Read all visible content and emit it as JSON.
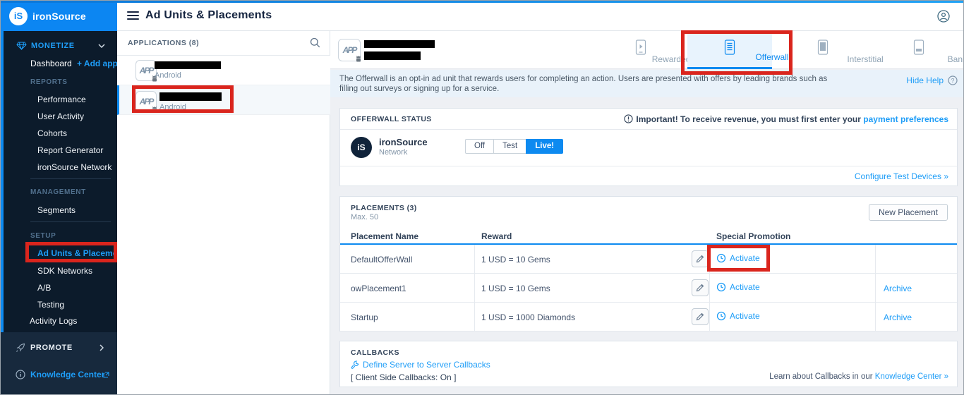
{
  "brand": {
    "logo_text": "iS",
    "name": "ironSource"
  },
  "top_bar": {
    "title": "Ad Units & Placements"
  },
  "sidebar": {
    "monetize_label": "MONETIZE",
    "dashboard_label": "Dashboard",
    "add_app_label": "+ Add app",
    "reports_label": "REPORTS",
    "reports_items": [
      "Performance",
      "User Activity",
      "Cohorts",
      "Report Generator",
      "ironSource Network"
    ],
    "management_label": "MANAGEMENT",
    "segments_label": "Segments",
    "setup_label": "SETUP",
    "setup_items": [
      "Ad Units & Placements",
      "SDK Networks",
      "A/B",
      "Testing"
    ],
    "activity_logs_label": "Activity Logs",
    "promote_label": "PROMOTE",
    "knowledge_center_label": "Knowledge Center"
  },
  "applications": {
    "header": "APPLICATIONS (8)",
    "icon_text": "APP",
    "items": [
      {
        "platform": "Android",
        "selected": false
      },
      {
        "platform": "Android",
        "selected": true
      }
    ]
  },
  "tabs": [
    {
      "label": "Rewarded Video",
      "selected": false
    },
    {
      "label": "Offerwall",
      "selected": true
    },
    {
      "label": "Interstitial",
      "selected": false
    },
    {
      "label": "Banner",
      "selected": false
    }
  ],
  "help_banner": {
    "text": "The Offerwall is an opt-in ad unit that rewards users for completing an action. Users are presented with offers by leading brands such as filling out surveys or signing up for a service.",
    "hide_help_label": "Hide Help"
  },
  "status_section": {
    "title": "OFFERWALL STATUS",
    "important_text": "Important! To receive revenue, you must first enter your",
    "important_link": "payment preferences",
    "network_logo_text": "iS",
    "network_name": "ironSource",
    "network_subtitle": "Network",
    "toggle_options": [
      "Off",
      "Test",
      "Live!"
    ],
    "active_option": "Live!",
    "configure_link": "Configure Test Devices »"
  },
  "placements": {
    "title": "PLACEMENTS (3)",
    "subtitle": "Max. 50",
    "new_placement_label": "New Placement",
    "columns": [
      "Placement Name",
      "Reward",
      "Special Promotion"
    ],
    "rows": [
      {
        "name": "DefaultOfferWall",
        "reward": "1 USD = 10 Gems",
        "promotion": "Activate",
        "archive": ""
      },
      {
        "name": "owPlacement1",
        "reward": "1 USD = 10 Gems",
        "promotion": "Activate",
        "archive": "Archive"
      },
      {
        "name": "Startup",
        "reward": "1 USD = 1000 Diamonds",
        "promotion": "Activate",
        "archive": "Archive"
      }
    ]
  },
  "callbacks": {
    "title": "CALLBACKS",
    "server_link": "Define Server to Server Callbacks",
    "client_side_text": "[ Client Side Callbacks: On ]",
    "learn_text": "Learn about Callbacks in our",
    "learn_link": "Knowledge Center »"
  },
  "colors": {
    "accent": "#0d8af0",
    "sidebar_dark": "#0c1b2b",
    "sidebar_light": "#17293d",
    "annotation_red": "#da251d",
    "help_banner_bg": "#e9f2fa"
  }
}
